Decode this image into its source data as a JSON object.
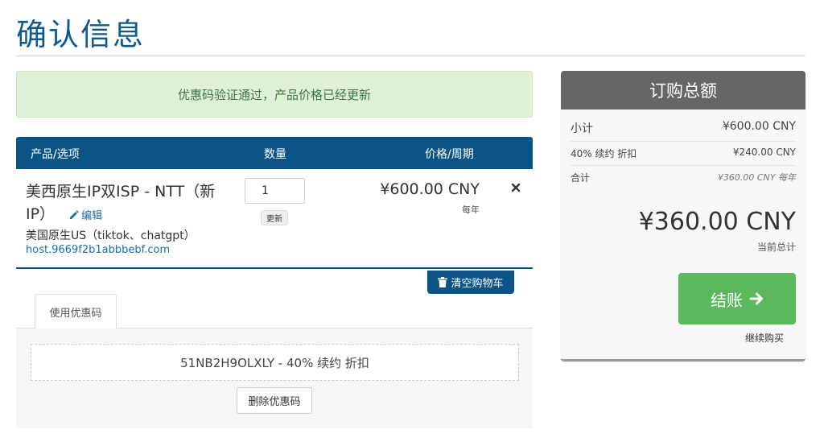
{
  "page": {
    "title": "确认信息"
  },
  "alert": {
    "message": "优惠码验证通过，产品价格已经更新"
  },
  "cart": {
    "headers": {
      "product": "产品/选项",
      "qty": "数量",
      "price": "价格/周期"
    },
    "item": {
      "name": "美西原生IP双ISP - NTT（新IP）",
      "edit_label": "编辑",
      "group": "美国原生US（tiktok、chatgpt）",
      "domain": "host.9669f2b1abbbebf.com",
      "quantity": "1",
      "update_label": "更新",
      "price": "¥600.00 CNY",
      "cycle": "每年"
    },
    "empty_cart_label": "清空购物车"
  },
  "promo": {
    "tab_label": "使用优惠码",
    "applied": "51NB2H9OLXLY - 40% 续约 折扣",
    "remove_label": "删除优惠码"
  },
  "summary": {
    "title": "订购总额",
    "subtotal_label": "小计",
    "subtotal_value": "¥600.00 CNY",
    "discount_label": "40% 续约 折扣",
    "discount_value": "¥240.00 CNY",
    "total_label": "合计",
    "total_value": "¥360.00 CNY 每年",
    "grand_total": "¥360.00 CNY",
    "grand_total_label": "当前总计",
    "checkout_label": "结账",
    "continue_label": "继续购买"
  },
  "colors": {
    "primary": "#0b5486",
    "success": "#5cb85c",
    "alert_bg": "#dff0d8",
    "summary_head": "#666666"
  }
}
